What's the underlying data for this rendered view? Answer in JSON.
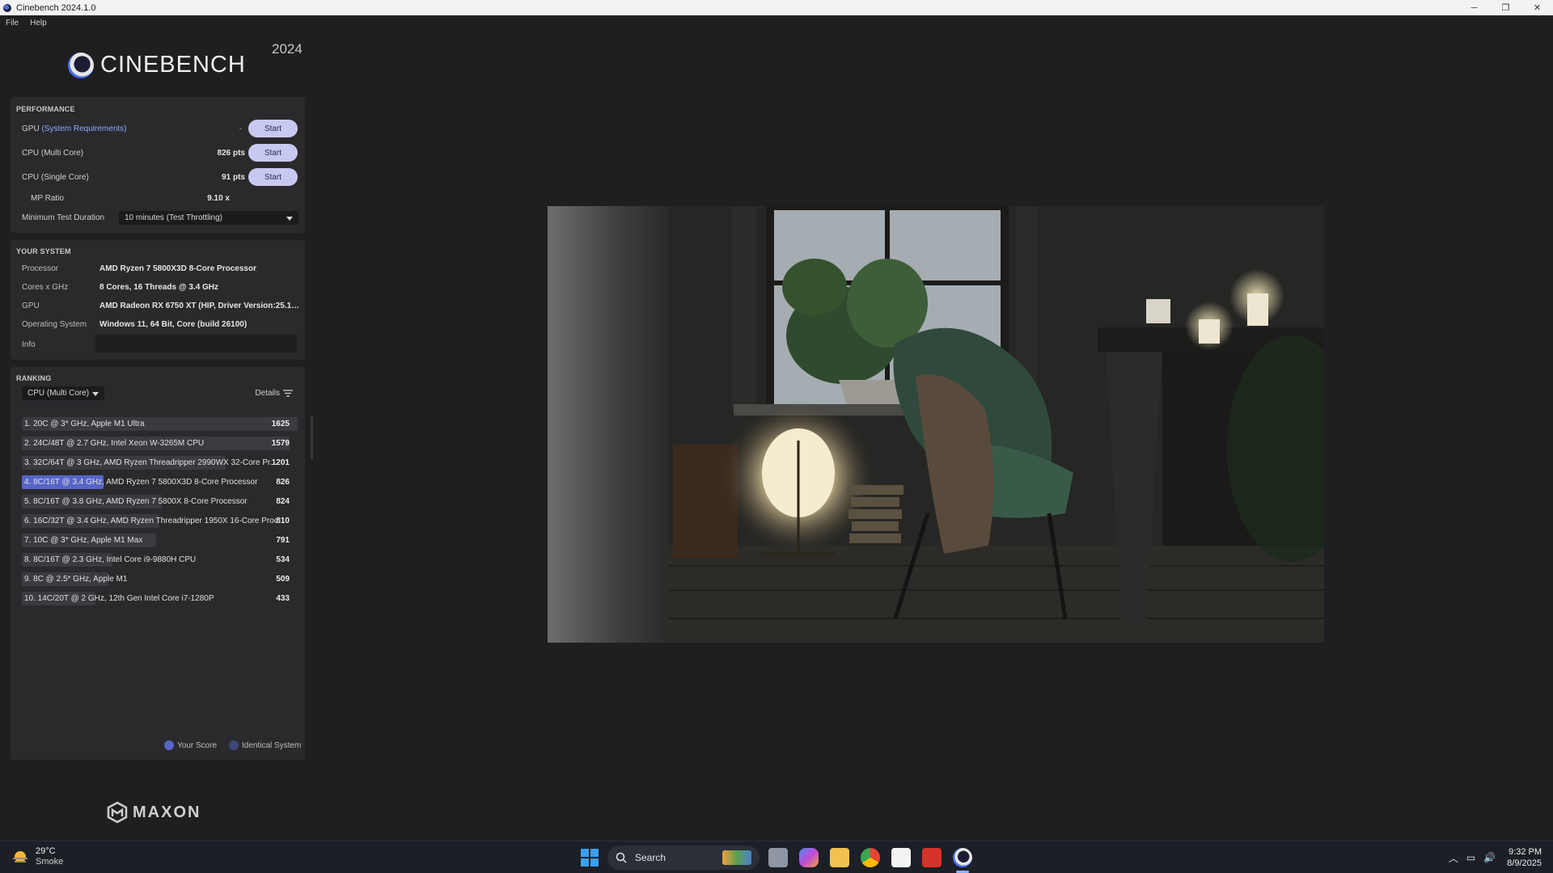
{
  "window": {
    "title": "Cinebench 2024.1.0",
    "controls": [
      "─",
      "❐",
      "✕"
    ]
  },
  "menu": [
    "File",
    "Help"
  ],
  "logo": {
    "name": "CINEBENCH",
    "year": "2024"
  },
  "performance": {
    "title": "PERFORMANCE",
    "rows": [
      {
        "label": "GPU",
        "link": "(System Requirements)",
        "value": "-",
        "button": "Start"
      },
      {
        "label": "CPU (Multi Core)",
        "value": "826 pts",
        "button": "Start"
      },
      {
        "label": "CPU (Single Core)",
        "value": "91 pts",
        "button": "Start"
      }
    ],
    "mp_ratio_label": "MP Ratio",
    "mp_ratio_value": "9.10 x",
    "min_duration_label": "Minimum Test Duration",
    "min_duration_value": "10 minutes (Test Throttling)"
  },
  "your_system": {
    "title": "YOUR SYSTEM",
    "rows": [
      {
        "label": "Processor",
        "value": "AMD Ryzen 7 5800X3D 8-Core Processor"
      },
      {
        "label": "Cores x GHz",
        "value": "8 Cores, 16 Threads @ 3.4 GHz"
      },
      {
        "label": "GPU",
        "value": "AMD Radeon RX 6750 XT (HIP, Driver Version:25.10.2..."
      },
      {
        "label": "Operating System",
        "value": "Windows 11, 64 Bit, Core (build 26100)"
      }
    ],
    "info_label": "Info",
    "info_value": ""
  },
  "ranking": {
    "title": "RANKING",
    "selector": "CPU (Multi Core)",
    "details": "Details",
    "max_score": 1625,
    "rows": [
      {
        "label": "1. 20C @ 3* GHz, Apple M1 Ultra",
        "score": 1625,
        "mine": false
      },
      {
        "label": "2. 24C/48T @ 2.7 GHz, Intel Xeon W-3265M CPU",
        "score": 1579,
        "mine": false
      },
      {
        "label": "3. 32C/64T @ 3 GHz, AMD Ryzen Threadripper 2990WX 32-Core Pr...",
        "score": 1201,
        "mine": false
      },
      {
        "label": "4. 8C/16T @ 3.4 GHz, AMD Ryzen 7 5800X3D 8-Core Processor",
        "score": 826,
        "mine": true
      },
      {
        "label": "5. 8C/16T @ 3.8 GHz, AMD Ryzen 7 5800X 8-Core Processor",
        "score": 824,
        "mine": false
      },
      {
        "label": "6. 16C/32T @ 3.4 GHz, AMD Ryzen Threadripper 1950X 16-Core Proc...",
        "score": 810,
        "mine": false
      },
      {
        "label": "7. 10C @ 3* GHz, Apple M1 Max",
        "score": 791,
        "mine": false
      },
      {
        "label": "8. 8C/16T @ 2.3 GHz, Intel Core i9-9880H CPU",
        "score": 534,
        "mine": false
      },
      {
        "label": "9. 8C @ 2.5* GHz, Apple M1",
        "score": 509,
        "mine": false
      },
      {
        "label": "10. 14C/20T @ 2 GHz, 12th Gen Intel Core i7-1280P",
        "score": 433,
        "mine": false
      }
    ],
    "legend": {
      "your_score": "Your Score",
      "identical": "Identical System",
      "your_color": "#5665c8",
      "identical_color": "#3d4678"
    }
  },
  "brand": {
    "maxon": "MAXON"
  },
  "taskbar": {
    "weather_temp": "29°C",
    "weather_cond": "Smoke",
    "search_placeholder": "Search",
    "time": "9:32 PM",
    "date": "8/9/2025",
    "apps": [
      "windows-start-icon",
      "task-view-icon",
      "copilot-icon",
      "file-explorer-icon",
      "chrome-icon",
      "microsoft-store-icon",
      "flash-app-icon",
      "cinebench-icon"
    ]
  },
  "colors": {
    "accent": "#5665c8",
    "start_button": "#c7c9f0",
    "panel": "#2a2a2d",
    "background": "#1f1f21"
  }
}
